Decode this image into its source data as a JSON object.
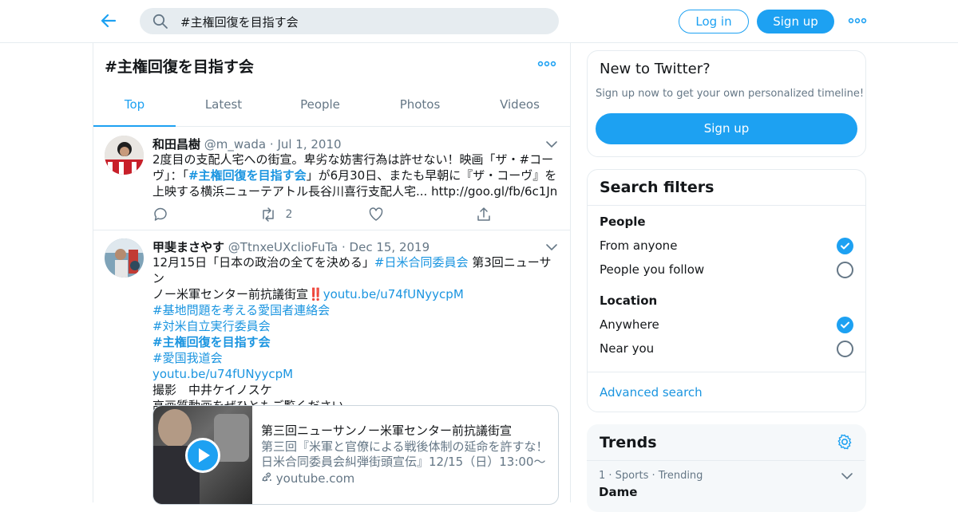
{
  "header": {
    "search_value": "#主権回復を目指す会",
    "login_label": "Log in",
    "signup_label": "Sign up"
  },
  "main": {
    "title": "#主権回復を目指す会",
    "tabs": [
      {
        "label": "Top",
        "active": true
      },
      {
        "label": "Latest",
        "active": false
      },
      {
        "label": "People",
        "active": false
      },
      {
        "label": "Photos",
        "active": false
      },
      {
        "label": "Videos",
        "active": false
      }
    ]
  },
  "tweets": [
    {
      "name": "和田昌樹",
      "handle": "@m_wada",
      "date": "Jul 1, 2010",
      "text_1": "2度目の支配人宅への街宣。卑劣な妨害行為は許せない！映画「ザ・#コー",
      "text_2a": "ヴ」：「",
      "text_2_hashtag": "#主権回復を目指す会",
      "text_2b": "」が6月30日、またも早朝に『ザ・コーヴ』を",
      "text_3a": "上映する横浜ニューテアトル長谷川喜行支配人宅... ",
      "text_3_link": "http://goo.gl/fb/6c1Jn",
      "retweets": "2"
    },
    {
      "name": "甲斐まさやす",
      "handle": "@TtnxeUXclioFuTa",
      "date": "Dec 15, 2019",
      "line_1a": "12月15日「日本の政治の全てを決める」",
      "line_1_hashtag": "#日米合同委員会",
      "line_1b": " 第3回ニューサン",
      "line_2a": "ノー米軍センター前抗議街宣",
      "line_2_emoji": "‼️",
      "line_2_link": "youtu.be/u74fUNyycpM",
      "line_3": "#基地問題を考える愛国者連絡会",
      "line_4": "#対米自立実行委員会",
      "line_5": "#主権回復を目指す会",
      "line_6": "#愛国我道会",
      "line_7": "youtu.be/u74fUNyycpM",
      "line_8": "撮影　中井ケイノスケ",
      "line_9": "高画質動画をぜひともご覧ください",
      "card": {
        "title": "第三回ニューサンノー米軍センター前抗議街宣",
        "description": "第三回『米軍と官僚による戦後体制の延命を許すな！日米合同委員会糾弾街頭宣伝』12/15（日）13:00～ ...",
        "url": "youtube.com"
      }
    }
  ],
  "sidebar": {
    "new_to_twitter": {
      "title": "New to Twitter?",
      "subtitle": "Sign up now to get your own personalized timeline!",
      "button": "Sign up"
    },
    "filters": {
      "title": "Search filters",
      "people_heading": "People",
      "people_options": [
        {
          "label": "From anyone",
          "checked": true
        },
        {
          "label": "People you follow",
          "checked": false
        }
      ],
      "location_heading": "Location",
      "location_options": [
        {
          "label": "Anywhere",
          "checked": true
        },
        {
          "label": "Near you",
          "checked": false
        }
      ],
      "advanced": "Advanced search"
    },
    "trends": {
      "title": "Trends",
      "items": [
        {
          "meta": "1 · Sports · Trending",
          "name": "Dame"
        }
      ]
    }
  },
  "colors": {
    "accent": "#1da1f2",
    "link": "#1b95e0",
    "muted": "#657786",
    "border": "#e6ecf0"
  }
}
